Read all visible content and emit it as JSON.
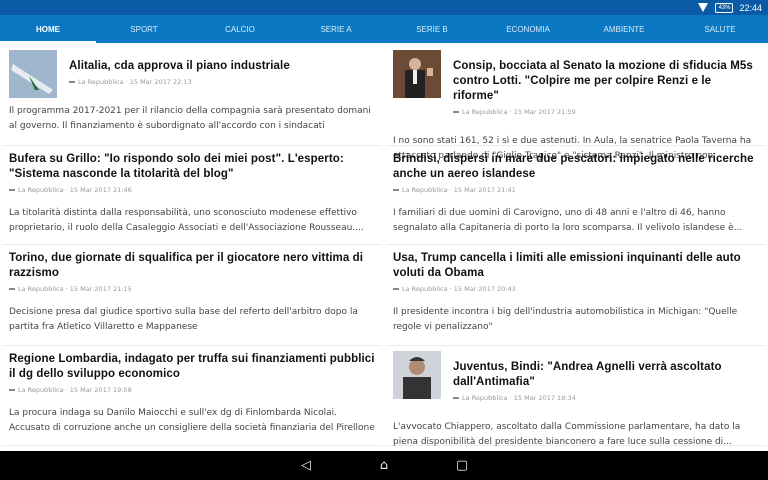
{
  "status_bar": {
    "battery": "43%",
    "time": "22:44"
  },
  "tabs": [
    "HOME",
    "SPORT",
    "CALCIO",
    "SERIE A",
    "SERIE B",
    "ECONOMIA",
    "AMBIENTE",
    "SALUTE"
  ],
  "active_tab": "HOME",
  "articles": [
    {
      "title": "Alitalia, cda approva il piano industriale",
      "source": "La Repubblica · 15 Mar 2017 22:13",
      "snippet": "Il programma 2017-2021 per il rilancio della compagnia sarà presentato domani al governo. Il finanziamento è subordignato all'accordo con i sindacati",
      "image": "airplane"
    },
    {
      "title": "Consip, bocciata al Senato la mozione di sfiducia M5s contro Lotti. \"Colpire me per colpire Renzi e le riforme\"",
      "source": "La Repubblica · 15 Mar 2017 21:59",
      "snippet": "I no sono stati 161, 52 i sì e due astenuti. In Aula, la senatrice Paola Taverna ha attaccato parlando di \"Giglio Tragico\" e \"sistema Renzi\". Il ministro non...",
      "image": "politician"
    },
    {
      "title": "Bufera su Grillo: \"Io rispondo solo dei miei post\". L'esperto: \"Sistema nasconde la titolarità del blog\"",
      "source": "La Repubblica · 15 Mar 2017 21:46",
      "snippet": "La titolarità distinta dalla responsabilità, uno sconosciuto modenese effettivo proprietario, il ruolo della Casaleggio Associati e dell'Associazione Rousseau...."
    },
    {
      "title": "Brindisi, dispersi in mare due pescatori: impiegato nelle ricerche anche un aereo islandese",
      "source": "La Repubblica · 15 Mar 2017 21:41",
      "snippet": "I familiari di due uomini di Carovigno, uno di 48 anni e l'altro di 46, hanno segnalato alla Capitaneria di porto la loro scomparsa. Il velivolo islandese è..."
    },
    {
      "title": "Torino, due giornate di squalifica per il giocatore nero vittima di razzismo",
      "source": "La Repubblica · 15 Mar 2017 21:15",
      "snippet": "Decisione presa dal giudice sportivo sulla base del referto dell'arbitro dopo la partita fra Atletico Villaretto e Mappanese"
    },
    {
      "title": "Usa, Trump cancella i limiti alle emissioni inquinanti delle auto voluti da Obama",
      "source": "La Repubblica · 15 Mar 2017 20:43",
      "snippet": "Il presidente incontra i big dell'industria automobilistica in Michigan: \"Quelle regole vi penalizzano\""
    },
    {
      "title": "Regione Lombardia, indagato per truffa sui finanziamenti pubblici il dg dello sviluppo economico",
      "source": "La Repubblica · 15 Mar 2017 19:58",
      "snippet": "La procura indaga su Danilo Maiocchi e sull'ex dg di Finlombarda Nicolai. Accusato di corruzione anche un consigliere della società finanziaria del Pirellone"
    },
    {
      "title": "Juventus, Bindi: \"Andrea Agnelli verrà ascoltato dall'Antimafia\"",
      "source": "La Repubblica · 15 Mar 2017 19:34",
      "snippet": "L'avvocato Chiappero, ascoltato dalla Commissione parlamentare, ha dato la piena disponibilità del presidente bianconero a fare luce sulla cessione di...",
      "image": "person"
    }
  ],
  "colors": {
    "status_bar": "#0b5aa6",
    "tab_bar": "#0a78c2"
  }
}
